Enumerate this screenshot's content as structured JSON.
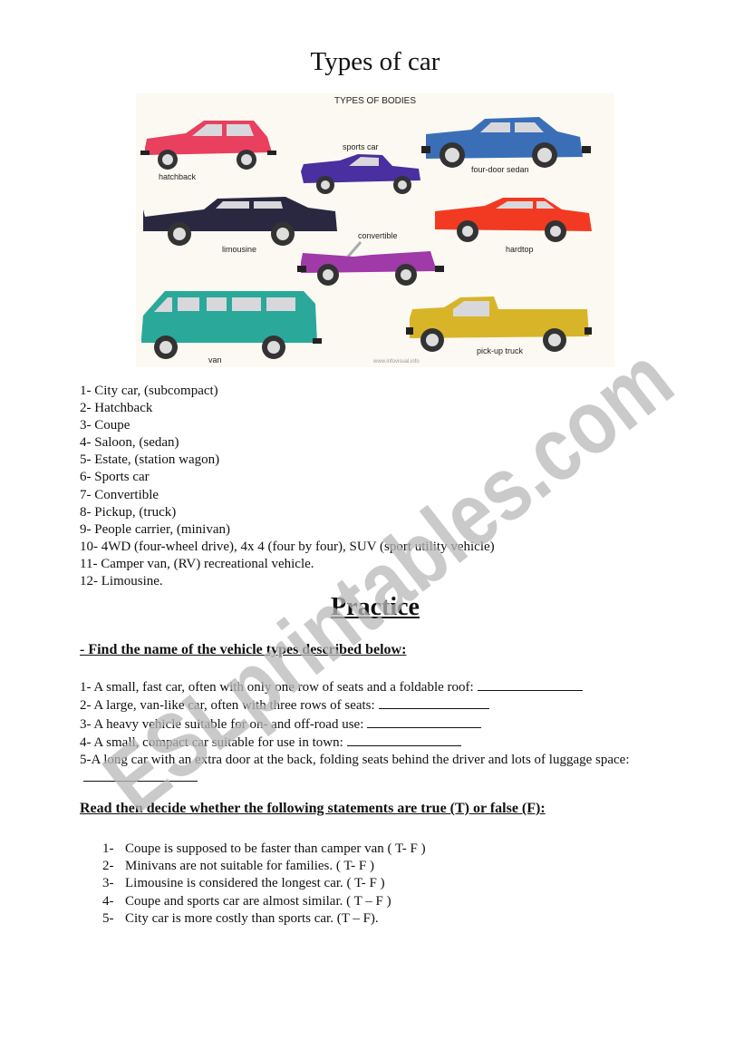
{
  "document": {
    "title": "Types of car",
    "illustration": {
      "heading": "TYPES OF BODIES",
      "credit": "www.infovisual.info",
      "vehicles": [
        {
          "label": "hatchback",
          "color": "#e8405e"
        },
        {
          "label": "sports car",
          "color": "#4a2fa0"
        },
        {
          "label": "four-door sedan",
          "color": "#3a6fb8"
        },
        {
          "label": "limousine",
          "color": "#2a2840"
        },
        {
          "label": "convertible",
          "color": "#a03aa8"
        },
        {
          "label": "hardtop",
          "color": "#f23a22"
        },
        {
          "label": "van",
          "color": "#2aa89a"
        },
        {
          "label": "pick-up truck",
          "color": "#d8b428"
        }
      ]
    },
    "types_list": [
      "1- City car, (subcompact)",
      "2- Hatchback",
      "3- Coupe",
      "4- Saloon, (sedan)",
      "5- Estate, (station wagon)",
      "6- Sports car",
      "7- Convertible",
      "8- Pickup, (truck)",
      "9- People carrier, (minivan)",
      "10- 4WD (four-wheel drive), 4x 4 (four by four), SUV (sport utility vehicle)",
      "11- Camper van, (RV) recreational vehicle.",
      "12- Limousine."
    ],
    "practice_heading": "Practice",
    "find_section": {
      "heading": "- Find the name of the vehicle types described below:",
      "items": [
        "1- A small, fast car, often with only one row of seats and a foldable roof:",
        "2- A large, van-like car, often with three rows of seats:",
        "3- A heavy vehicle suitable for on- and off-road use:",
        "4- A small, compact car suitable for use in town:",
        "5-A long car with an extra door at the back, folding seats behind the driver and lots of luggage space:"
      ]
    },
    "tf_section": {
      "heading": "Read then decide whether the following statements are true (T) or false (F):",
      "items": [
        {
          "num": "1-",
          "text": "Coupe is supposed to be faster than camper van ( T- F )"
        },
        {
          "num": "2-",
          "text": "Minivans are not suitable for families. ( T- F )"
        },
        {
          "num": "3-",
          "text": "Limousine is considered the longest car. ( T- F )"
        },
        {
          "num": "4-",
          "text": "Coupe and sports car are almost similar. ( T – F )"
        },
        {
          "num": "5-",
          "text": "City car is more costly than sports car. (T – F)."
        }
      ]
    },
    "watermark": "ESLprintables.com"
  }
}
